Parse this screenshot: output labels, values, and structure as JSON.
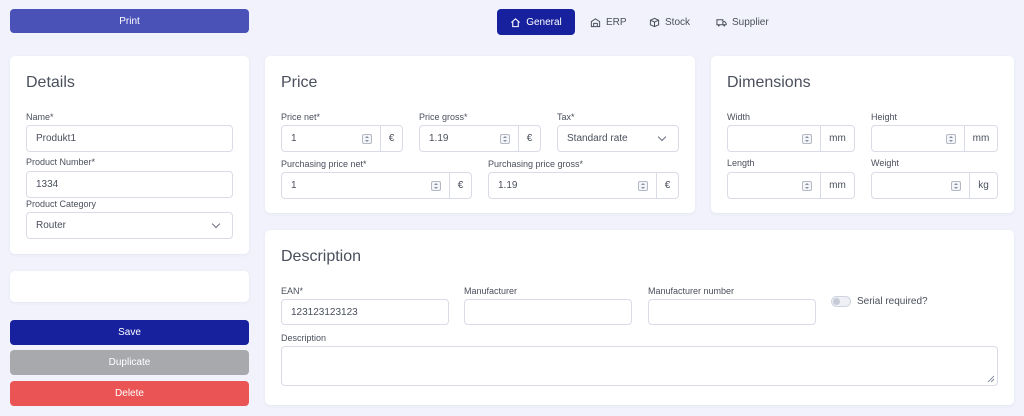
{
  "toolbar": {
    "print_label": "Print"
  },
  "tabs": [
    {
      "label": "General",
      "icon": "home-icon",
      "active": true
    },
    {
      "label": "ERP",
      "icon": "building-icon",
      "active": false
    },
    {
      "label": "Stock",
      "icon": "box-icon",
      "active": false
    },
    {
      "label": "Supplier",
      "icon": "truck-icon",
      "active": false
    }
  ],
  "details": {
    "title": "Details",
    "name_label": "Name*",
    "name_value": "Produkt1",
    "number_label": "Product Number*",
    "number_value": "1334",
    "category_label": "Product Category",
    "category_value": "Router"
  },
  "price": {
    "title": "Price",
    "net_label": "Price net*",
    "net_value": "1",
    "gross_label": "Price gross*",
    "gross_value": "1.19",
    "tax_label": "Tax*",
    "tax_value": "Standard rate",
    "purchasing_net_label": "Purchasing price net*",
    "purchasing_net_value": "1",
    "purchasing_gross_label": "Purchasing price gross*",
    "purchasing_gross_value": "1.19",
    "currency": "€"
  },
  "dimensions": {
    "title": "Dimensions",
    "width_label": "Width",
    "width_unit": "mm",
    "height_label": "Height",
    "height_unit": "mm",
    "length_label": "Length",
    "length_unit": "mm",
    "weight_label": "Weight",
    "weight_unit": "kg"
  },
  "description": {
    "title": "Description",
    "ean_label": "EAN*",
    "ean_value": "123123123123",
    "manufacturer_label": "Manufacturer",
    "manufacturer_value": "",
    "manufacturer_number_label": "Manufacturer number",
    "manufacturer_number_value": "",
    "serial_label": "Serial required?",
    "description_label": "Description",
    "description_value": ""
  },
  "actions": {
    "save_label": "Save",
    "duplicate_label": "Duplicate",
    "delete_label": "Delete"
  },
  "colors": {
    "primary": "#17219e",
    "print_button": "#4a52b8",
    "disabled": "#a8a9ad",
    "danger": "#ea5455",
    "background": "#f1f2fb"
  }
}
